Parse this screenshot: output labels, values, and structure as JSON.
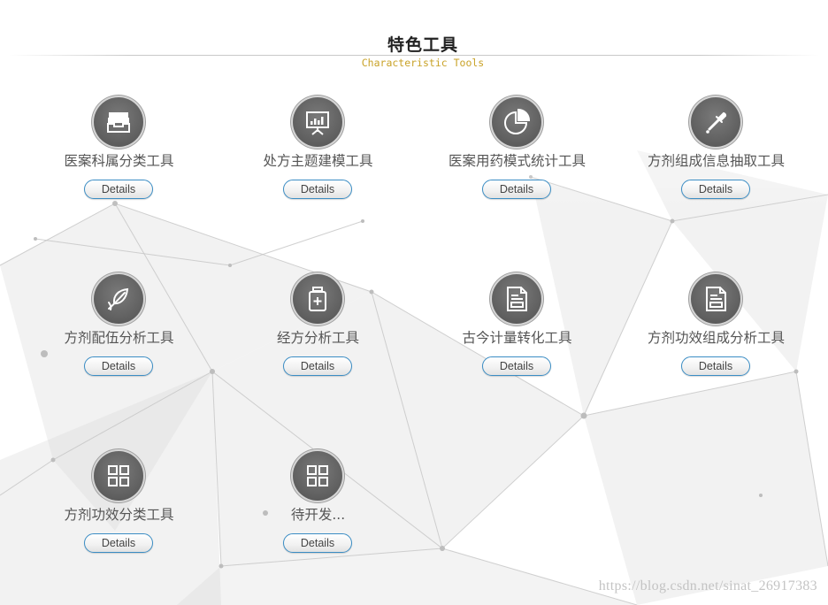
{
  "header": {
    "title": "特色工具",
    "subtitle": "Characteristic Tools"
  },
  "tools": [
    {
      "name": "医案科属分类工具",
      "icon": "inbox-tray-icon",
      "button": "Details"
    },
    {
      "name": "处方主题建模工具",
      "icon": "presentation-board-icon",
      "button": "Details"
    },
    {
      "name": "医案用药模式统计工具",
      "icon": "pie-chart-icon",
      "button": "Details"
    },
    {
      "name": "方剂组成信息抽取工具",
      "icon": "dropper-icon",
      "button": "Details"
    },
    {
      "name": "方剂配伍分析工具",
      "icon": "leaf-feather-icon",
      "button": "Details"
    },
    {
      "name": "经方分析工具",
      "icon": "medicine-bottle-icon",
      "button": "Details"
    },
    {
      "name": "古今计量转化工具",
      "icon": "document-icon",
      "button": "Details"
    },
    {
      "name": "方剂功效组成分析工具",
      "icon": "document-icon",
      "button": "Details"
    },
    {
      "name": "方剂功效分类工具",
      "icon": "grid-four-icon",
      "button": "Details"
    },
    {
      "name": "待开发...",
      "icon": "grid-four-icon",
      "button": "Details"
    }
  ],
  "watermark": "https://blog.csdn.net/sinat_26917383",
  "colors": {
    "title": "#222222",
    "subtitle": "#c9a227",
    "icon_fill": "#666666",
    "button_border": "#3b8dc4",
    "text": "#555555"
  }
}
